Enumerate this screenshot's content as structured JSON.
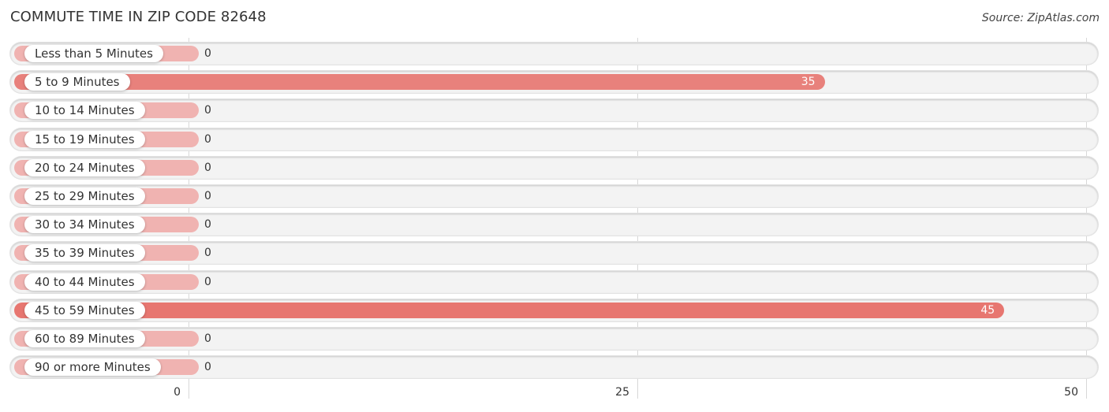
{
  "header": {
    "title": "COMMUTE TIME IN ZIP CODE 82648",
    "source": "Source: ZipAtlas.com"
  },
  "colors": {
    "bar_highlight": "#e8817c",
    "bar_strong": "#e77670",
    "bar_zero": "#f0b3b1",
    "row_background": "#f3f3f3"
  },
  "chart_data": {
    "type": "bar",
    "orientation": "horizontal",
    "title": "COMMUTE TIME IN ZIP CODE 82648",
    "xlabel": "",
    "ylabel": "",
    "categories": [
      "Less than 5 Minutes",
      "5 to 9 Minutes",
      "10 to 14 Minutes",
      "15 to 19 Minutes",
      "20 to 24 Minutes",
      "25 to 29 Minutes",
      "30 to 34 Minutes",
      "35 to 39 Minutes",
      "40 to 44 Minutes",
      "45 to 59 Minutes",
      "60 to 89 Minutes",
      "90 or more Minutes"
    ],
    "values": [
      0,
      35,
      0,
      0,
      0,
      0,
      0,
      0,
      0,
      45,
      0,
      0
    ],
    "value_labels": [
      "0",
      "35",
      "0",
      "0",
      "0",
      "0",
      "0",
      "0",
      "0",
      "45",
      "0",
      "0"
    ],
    "xlim": [
      0,
      50
    ],
    "xticks": [
      0,
      25,
      50
    ],
    "xtick_labels": [
      "0",
      "25",
      "50"
    ],
    "grid": true,
    "legend": "none"
  }
}
